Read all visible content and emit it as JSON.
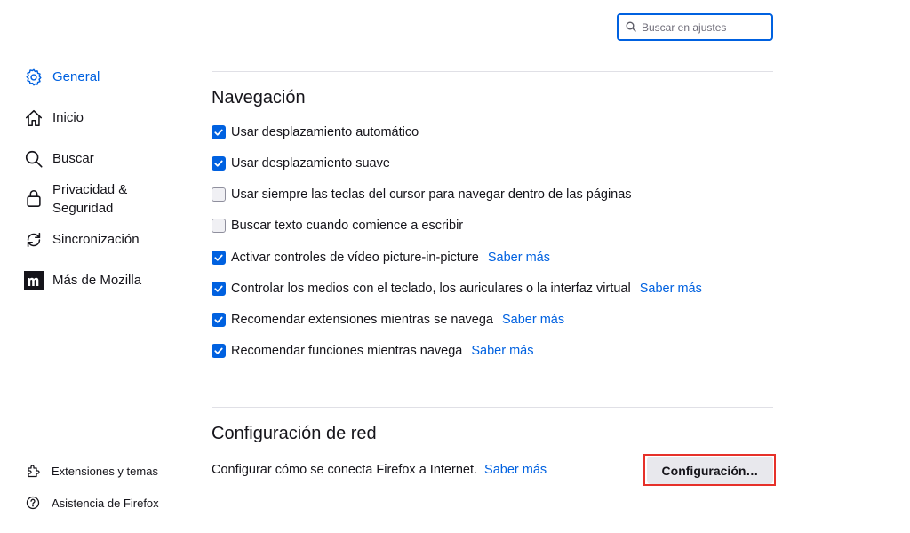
{
  "search": {
    "placeholder": "Buscar en ajustes",
    "value": ""
  },
  "sidebar": {
    "items": [
      {
        "label": "General",
        "icon": "gear-icon",
        "selected": true
      },
      {
        "label": "Inicio",
        "icon": "home-icon",
        "selected": false
      },
      {
        "label": "Buscar",
        "icon": "search-icon",
        "selected": false
      },
      {
        "label_line1": "Privacidad &",
        "label_line2": "Seguridad",
        "icon": "lock-icon",
        "selected": false
      },
      {
        "label": "Sincronización",
        "icon": "sync-icon",
        "selected": false
      },
      {
        "label": "Más de Mozilla",
        "icon": "mozilla-icon",
        "selected": false
      }
    ],
    "footer": [
      {
        "label": "Extensiones y temas",
        "icon": "puzzle-icon"
      },
      {
        "label": "Asistencia de Firefox",
        "icon": "help-icon"
      }
    ]
  },
  "navigation": {
    "title": "Navegación",
    "options": [
      {
        "label": "Usar desplazamiento automático",
        "checked": true,
        "link": ""
      },
      {
        "label": "Usar desplazamiento suave",
        "checked": true,
        "link": ""
      },
      {
        "label": "Usar siempre las teclas del cursor para navegar dentro de las páginas",
        "checked": false,
        "link": ""
      },
      {
        "label": "Buscar texto cuando comience a escribir",
        "checked": false,
        "link": ""
      },
      {
        "label": "Activar controles de vídeo picture-in-picture",
        "checked": true,
        "link": "Saber más"
      },
      {
        "label": "Controlar los medios con el teclado, los auriculares o la interfaz virtual",
        "checked": true,
        "link": "Saber más"
      },
      {
        "label": "Recomendar extensiones mientras se navega",
        "checked": true,
        "link": "Saber más"
      },
      {
        "label": "Recomendar funciones mientras navega",
        "checked": true,
        "link": "Saber más"
      }
    ]
  },
  "network": {
    "title": "Configuración de red",
    "description": "Configurar cómo se conecta Firefox a Internet.",
    "link": "Saber más",
    "button_label": "Configuración…"
  },
  "colors": {
    "accent": "#0061e0",
    "highlight_border": "#e6312a"
  }
}
